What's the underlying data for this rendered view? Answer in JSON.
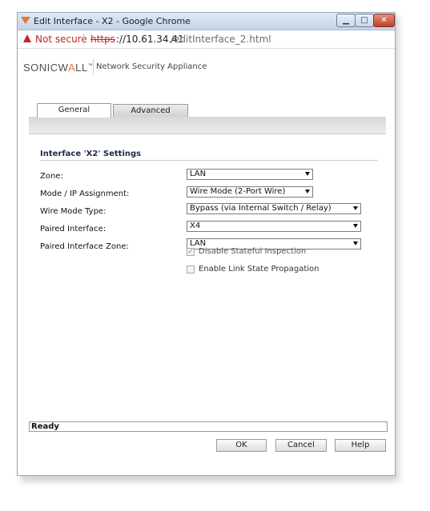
{
  "window": {
    "title": "Edit Interface - X2 - Google Chrome"
  },
  "address_bar": {
    "security_label": "Not secure",
    "scheme": "https",
    "host": "://10.61.34.41",
    "path": "/editInterface_2.html"
  },
  "header": {
    "logo_text_1": "SONICW",
    "logo_text_2": "A",
    "logo_text_3": "LL",
    "logo_tm": "™",
    "product": "Network Security Appliance"
  },
  "tabs": [
    {
      "label": "General",
      "active": true
    },
    {
      "label": "Advanced",
      "active": false
    }
  ],
  "settings": {
    "title": "Interface 'X2' Settings",
    "fields": [
      {
        "label": "Zone:",
        "value": "LAN"
      },
      {
        "label": "Mode / IP Assignment:",
        "value": "Wire Mode (2-Port Wire)"
      },
      {
        "label": "Wire Mode Type:",
        "value": "Bypass (via Internal Switch / Relay)"
      },
      {
        "label": "Paired Interface:",
        "value": "X4"
      },
      {
        "label": "Paired Interface Zone:",
        "value": "LAN"
      }
    ],
    "checkboxes": [
      {
        "label": "Disable Stateful Inspection",
        "checked": true,
        "disabled": true
      },
      {
        "label": "Enable Link State Propagation",
        "checked": false,
        "disabled": false
      }
    ]
  },
  "status": "Ready",
  "buttons": {
    "ok": "OK",
    "cancel": "Cancel",
    "help": "Help"
  },
  "colors": {
    "accent": "#e8772e",
    "warning": "#c5221f",
    "section_title": "#1a2a4a"
  }
}
